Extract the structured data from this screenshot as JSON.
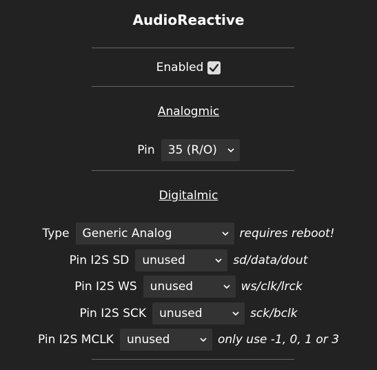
{
  "title": "AudioReactive",
  "enabled": {
    "label": "Enabled",
    "checked": true
  },
  "analog_section": {
    "heading": "Analogmic",
    "pin_label": "Pin",
    "pin_value": "35 (R/O)"
  },
  "digital_section": {
    "heading": "Digitalmic",
    "rows": [
      {
        "label": "Type",
        "value": "Generic Analog",
        "note": "requires reboot!"
      },
      {
        "label": "Pin I2S SD",
        "value": "unused",
        "note": "sd/data/dout"
      },
      {
        "label": "Pin I2S WS",
        "value": "unused",
        "note": "ws/clk/lrck"
      },
      {
        "label": "Pin I2S SCK",
        "value": "unused",
        "note": "sck/bclk"
      },
      {
        "label": "Pin I2S MCLK",
        "value": "unused",
        "note": "only use -1, 0, 1 or 3"
      }
    ]
  },
  "colors": {
    "background": "#222222",
    "select_bg": "#333333",
    "text": "#ffffff",
    "divider": "#666666"
  },
  "icons": {
    "checkbox": "checkmark-icon",
    "dropdown": "chevron-down-icon"
  }
}
